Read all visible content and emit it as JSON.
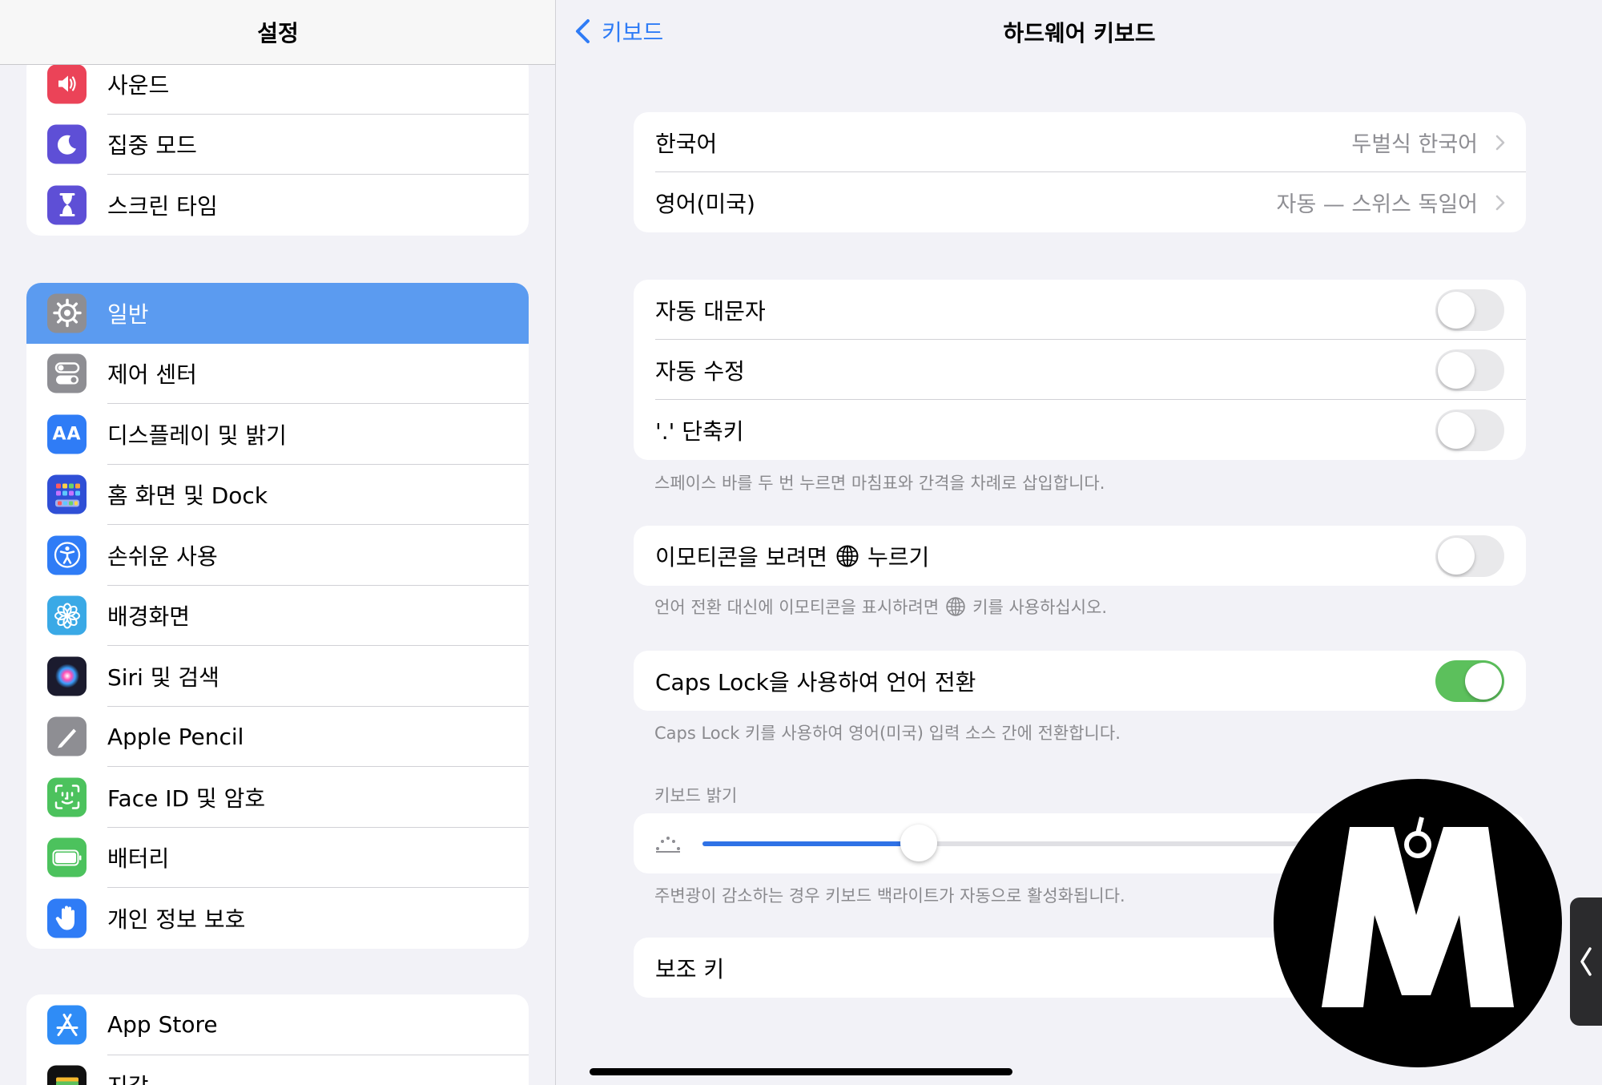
{
  "sidebar": {
    "title": "설정",
    "group1": [
      {
        "label": "사운드",
        "icon": "speaker-icon",
        "color": "#eb4358"
      },
      {
        "label": "집중 모드",
        "icon": "moon-icon",
        "color": "#5e4fd6"
      },
      {
        "label": "스크린 타임",
        "icon": "hourglass-icon",
        "color": "#5e4fd6"
      }
    ],
    "group2": [
      {
        "label": "일반",
        "icon": "gear-icon",
        "color": "#8e8e93",
        "selected": true
      },
      {
        "label": "제어 센터",
        "icon": "switches-icon",
        "color": "#8e8e93"
      },
      {
        "label": "디스플레이 및 밝기",
        "icon": "text-size-icon",
        "color": "#2f7cf6",
        "glyph": "AA"
      },
      {
        "label": "홈 화면 및 Dock",
        "icon": "grid-icon",
        "color": "#2f4fd6"
      },
      {
        "label": "손쉬운 사용",
        "icon": "accessibility-icon",
        "color": "#2f7cf6"
      },
      {
        "label": "배경화면",
        "icon": "flower-icon",
        "color": "#3aa9e6"
      },
      {
        "label": "Siri 및 검색",
        "icon": "siri-icon",
        "color": "#1b1b2e"
      },
      {
        "label": "Apple Pencil",
        "icon": "pencil-icon",
        "color": "#8e8e93"
      },
      {
        "label": "Face ID 및 암호",
        "icon": "face-id-icon",
        "color": "#4cc25d"
      },
      {
        "label": "배터리",
        "icon": "battery-icon",
        "color": "#4cc25d"
      },
      {
        "label": "개인 정보 보호",
        "icon": "hand-icon",
        "color": "#2f7cf6"
      }
    ],
    "group3": [
      {
        "label": "App Store",
        "icon": "app-store-icon",
        "color": "#2f8cf6"
      },
      {
        "label": "지갑",
        "icon": "wallet-icon",
        "color": "#111111"
      }
    ]
  },
  "detail": {
    "back_label": "키보드",
    "title": "하드웨어 키보드",
    "languages": [
      {
        "label": "한국어",
        "value": "두벌식 한국어"
      },
      {
        "label": "영어(미국)",
        "value": "자동 — 스위스 독일어"
      }
    ],
    "toggles": [
      {
        "label": "자동 대문자",
        "on": false
      },
      {
        "label": "자동 수정",
        "on": false
      },
      {
        "label": "'.' 단축키",
        "on": false
      }
    ],
    "period_footnote": "스페이스 바를 두 번 누르면 마침표와 간격을 차례로 삽입합니다.",
    "emoji_label_prefix": "이모티콘을 보려면",
    "emoji_label_suffix": "누르기",
    "emoji_on": false,
    "emoji_footnote_prefix": "언어 전환 대신에 이모티콘을 표시하려면",
    "emoji_footnote_suffix": "키를 사용하십시오.",
    "capslock_label": "Caps Lock을 사용하여 언어 전환",
    "capslock_on": true,
    "capslock_footnote": "Caps Lock 키를 사용하여 영어(미국) 입력 소스 간에 전환합니다.",
    "brightness_header": "키보드 밝기",
    "brightness_level": 0.35,
    "brightness_footnote": "주변광이 감소하는 경우 키보드 백라이트가 자동으로 활성화됩니다.",
    "modifier_label": "보조 키"
  },
  "colors": {
    "accent": "#2f7cf6",
    "toggle_on": "#5cc05c",
    "selected_row": "#5b9bf0"
  }
}
